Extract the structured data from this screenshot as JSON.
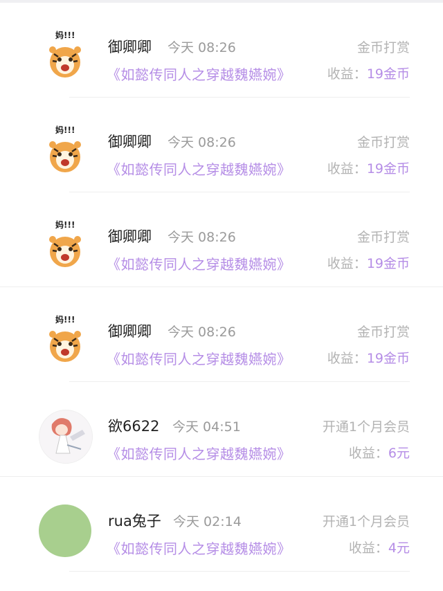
{
  "items": [
    {
      "avatar": "tiger-sticker-icon",
      "avatar_text": "妈!!!",
      "name": "御卿卿",
      "time": "今天 08:26",
      "book": "《如懿传同人之穿越魏嬿婉》",
      "type": "金币打赏",
      "earn_label": "收益：",
      "earn_amount": "19金币"
    },
    {
      "avatar": "tiger-sticker-icon",
      "avatar_text": "妈!!!",
      "name": "御卿卿",
      "time": "今天 08:26",
      "book": "《如懿传同人之穿越魏嬿婉》",
      "type": "金币打赏",
      "earn_label": "收益：",
      "earn_amount": "19金币"
    },
    {
      "avatar": "tiger-sticker-icon",
      "avatar_text": "妈!!!",
      "name": "御卿卿",
      "time": "今天 08:26",
      "book": "《如懿传同人之穿越魏嬿婉》",
      "type": "金币打赏",
      "earn_label": "收益：",
      "earn_amount": "19金币"
    },
    {
      "avatar": "tiger-sticker-icon",
      "avatar_text": "妈!!!",
      "name": "御卿卿",
      "time": "今天 08:26",
      "book": "《如懿传同人之穿越魏嬿婉》",
      "type": "金币打赏",
      "earn_label": "收益：",
      "earn_amount": "19金币"
    },
    {
      "avatar": "anime-girl-avatar",
      "name": "欲6622",
      "time": "今天 04:51",
      "book": "《如懿传同人之穿越魏嬿婉》",
      "type": "开通1个月会员",
      "earn_label": "收益：",
      "earn_amount": "6元"
    },
    {
      "avatar": "green-circle-avatar",
      "name": "rua兔子",
      "time": "今天 02:14",
      "book": "《如懿传同人之穿越魏嬿婉》",
      "type": "开通1个月会员",
      "earn_label": "收益：",
      "earn_amount": "4元"
    }
  ],
  "colors": {
    "accent": "#b58de6",
    "muted": "#b3b3b3",
    "name": "#222222",
    "avatar_green": "#a8cf8e"
  }
}
